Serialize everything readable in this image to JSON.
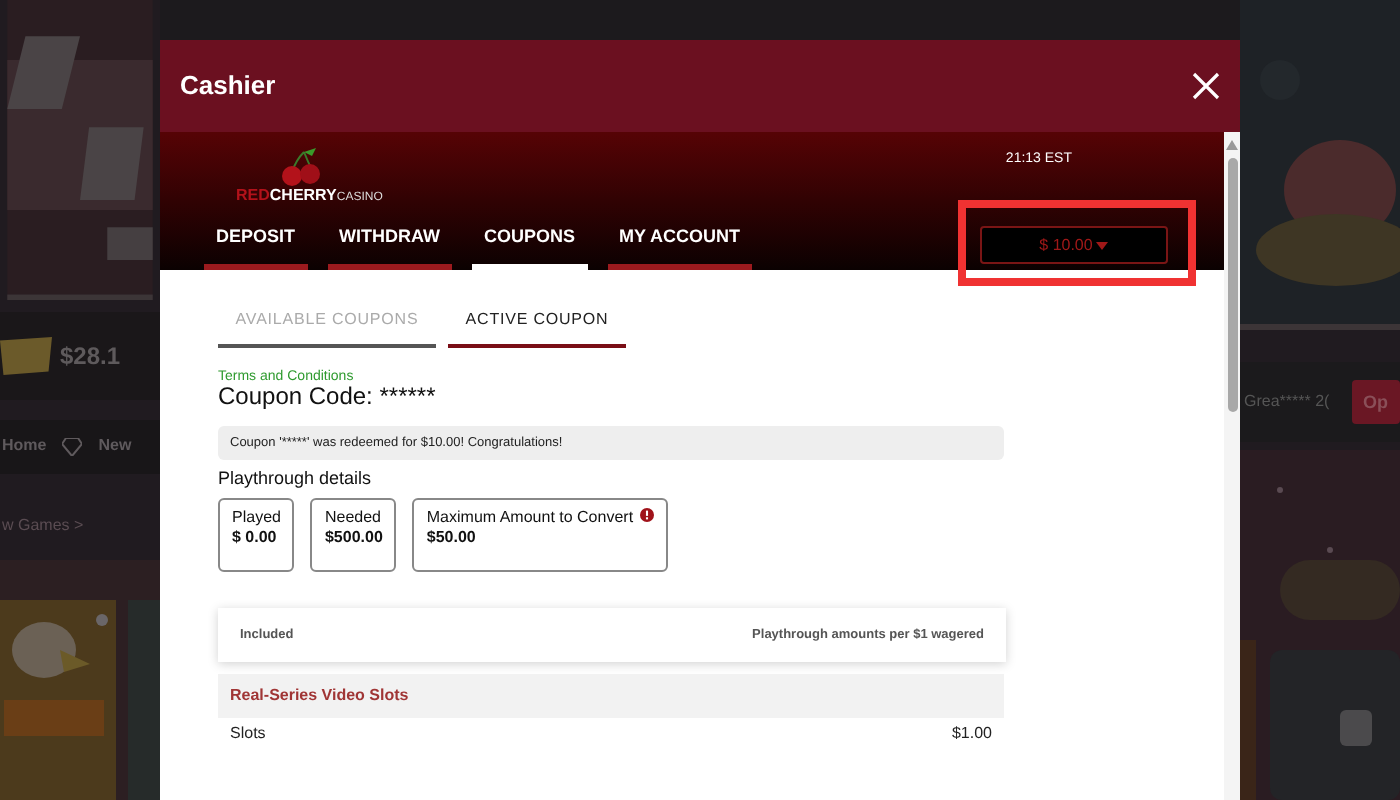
{
  "backdrop": {
    "jackpot": "$28.1",
    "nav": [
      {
        "label": "Home",
        "icon": false
      },
      {
        "label": "New",
        "icon": true
      }
    ],
    "section_link": "w Games >",
    "ticker": "Grea***** 2(",
    "option_button": "Op"
  },
  "dialog": {
    "title": "Cashier",
    "logo": [
      "RED",
      "CHERRY",
      "CASINO"
    ],
    "time": "21:13 EST",
    "tabs": [
      {
        "label": "DEPOSIT",
        "selected": false
      },
      {
        "label": "WITHDRAW",
        "selected": false
      },
      {
        "label": "COUPONS",
        "selected": true
      },
      {
        "label": "MY ACCOUNT",
        "selected": false
      }
    ],
    "balance": "$ 10.00",
    "balance_highlighted": true,
    "subtabs": [
      {
        "label": "AVAILABLE COUPONS",
        "selected": false
      },
      {
        "label": "ACTIVE COUPON",
        "selected": true
      }
    ],
    "terms_link": "Terms and Conditions",
    "coupon_code": "Coupon Code: ******",
    "alert": "Coupon '*****' was redeemed for $10.00! Congratulations!",
    "playthrough": {
      "title": "Playthrough details",
      "stats": [
        {
          "label": "Played",
          "value": "$ 0.00",
          "info": false
        },
        {
          "label": "Needed",
          "value": "$500.00",
          "info": false
        },
        {
          "label": "Maximum Amount to Convert",
          "value": "$50.00",
          "info": true
        }
      ]
    },
    "table": {
      "columns": [
        "Included",
        "Playthrough amounts per $1 wagered"
      ],
      "groups": [
        {
          "name": "Real-Series Video Slots",
          "rows": [
            {
              "game": "Slots",
              "amount": "$1.00"
            }
          ]
        }
      ]
    }
  }
}
